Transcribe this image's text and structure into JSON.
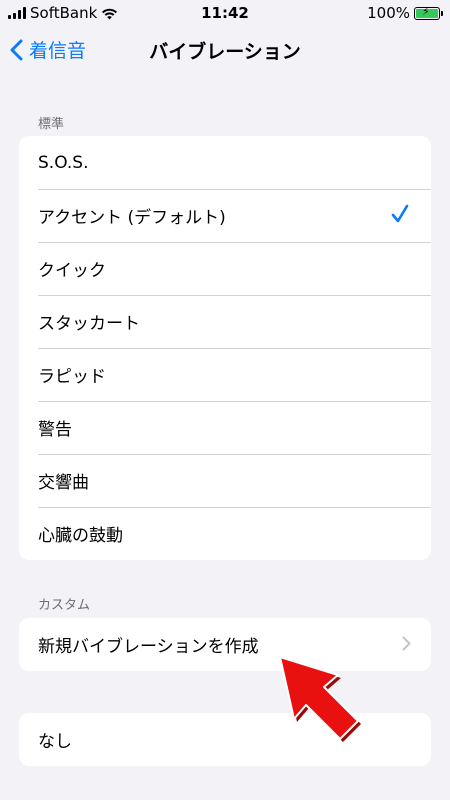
{
  "status": {
    "carrier": "SoftBank",
    "time": "11:42",
    "battery": "100%"
  },
  "nav": {
    "back_label": "着信音",
    "title": "バイブレーション"
  },
  "standard": {
    "header": "標準",
    "items": [
      {
        "label": "S.O.S.",
        "checked": false
      },
      {
        "label": "アクセント (デフォルト)",
        "checked": true
      },
      {
        "label": "クイック",
        "checked": false
      },
      {
        "label": "スタッカート",
        "checked": false
      },
      {
        "label": "ラピッド",
        "checked": false
      },
      {
        "label": "警告",
        "checked": false
      },
      {
        "label": "交響曲",
        "checked": false
      },
      {
        "label": "心臓の鼓動",
        "checked": false
      }
    ]
  },
  "custom": {
    "header": "カスタム",
    "create_label": "新規バイブレーションを作成"
  },
  "none": {
    "label": "なし"
  },
  "colors": {
    "accent": "#0a7aff",
    "annotation_arrow": "#e8110f"
  }
}
